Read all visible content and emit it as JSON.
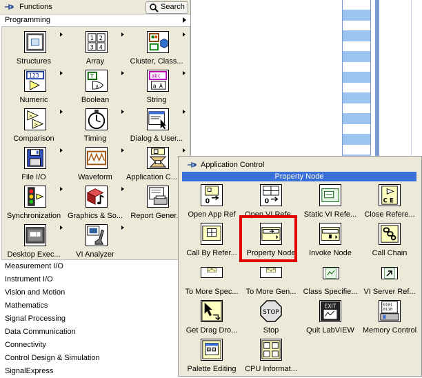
{
  "functions_palette": {
    "title": "Functions",
    "search_label": "Search",
    "category": "Programming",
    "items": [
      {
        "label": "Structures",
        "icon": "structures-icon"
      },
      {
        "label": "Array",
        "icon": "array-icon"
      },
      {
        "label": "Cluster, Class...",
        "icon": "cluster-class-icon"
      },
      {
        "label": "Numeric",
        "icon": "numeric-icon"
      },
      {
        "label": "Boolean",
        "icon": "boolean-icon"
      },
      {
        "label": "String",
        "icon": "string-icon"
      },
      {
        "label": "Comparison",
        "icon": "comparison-icon"
      },
      {
        "label": "Timing",
        "icon": "timing-icon"
      },
      {
        "label": "Dialog & User...",
        "icon": "dialog-icon"
      },
      {
        "label": "File I/O",
        "icon": "file-io-icon"
      },
      {
        "label": "Waveform",
        "icon": "waveform-icon"
      },
      {
        "label": "Application C...",
        "icon": "application-control-icon"
      },
      {
        "label": "Synchronization",
        "icon": "synchronization-icon"
      },
      {
        "label": "Graphics & So...",
        "icon": "graphics-sound-icon"
      },
      {
        "label": "Report Gener...",
        "icon": "report-generation-icon"
      },
      {
        "label": "Desktop Exec...",
        "icon": "desktop-execution-icon"
      },
      {
        "label": "VI Analyzer",
        "icon": "vi-analyzer-icon"
      }
    ],
    "categories": [
      "Measurement I/O",
      "Instrument I/O",
      "Vision and Motion",
      "Mathematics",
      "Signal Processing",
      "Data Communication",
      "Connectivity",
      "Control Design & Simulation",
      "SignalExpress"
    ]
  },
  "app_control_palette": {
    "title": "Application Control",
    "selected_item": "Property Node",
    "items": [
      {
        "label": "Open App Ref",
        "icon": "open-app-ref-icon"
      },
      {
        "label": "Open VI Refe...",
        "icon": "open-vi-reference-icon"
      },
      {
        "label": "Static VI Refe...",
        "icon": "static-vi-reference-icon"
      },
      {
        "label": "Close Refere...",
        "icon": "close-reference-icon"
      },
      {
        "label": "Call By Refer...",
        "icon": "call-by-reference-icon"
      },
      {
        "label": "Property Node",
        "icon": "property-node-icon"
      },
      {
        "label": "Invoke Node",
        "icon": "invoke-node-icon"
      },
      {
        "label": "Call Chain",
        "icon": "call-chain-icon"
      },
      {
        "label": "To More Spec...",
        "icon": "to-more-specific-icon"
      },
      {
        "label": "To More Gen...",
        "icon": "to-more-generic-icon"
      },
      {
        "label": "Class Specifie...",
        "icon": "class-specifier-icon"
      },
      {
        "label": "VI Server Ref...",
        "icon": "vi-server-reference-icon"
      },
      {
        "label": "Get Drag Dro...",
        "icon": "get-drag-drop-icon"
      },
      {
        "label": "Stop",
        "icon": "stop-icon"
      },
      {
        "label": "Quit LabVIEW",
        "icon": "quit-labview-icon"
      },
      {
        "label": "Memory Control",
        "icon": "memory-control-icon"
      },
      {
        "label": "Palette Editing",
        "icon": "palette-editing-icon"
      },
      {
        "label": "CPU Informat...",
        "icon": "cpu-information-icon"
      }
    ],
    "stop_text": "STOP",
    "exit_text": "EXIT"
  },
  "colors": {
    "palette_bg": "#ece9d8",
    "selection_bar": "#3a6fd8",
    "highlight": "#e00000"
  }
}
